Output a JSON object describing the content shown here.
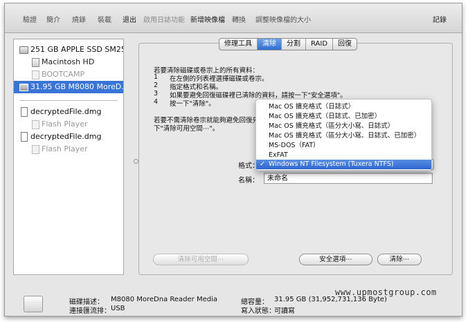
{
  "toolbar": {
    "items": [
      "驗證",
      "簡介",
      "燒錄",
      "裝載",
      "退出",
      "啟用日誌功能",
      "新增映像檔",
      "轉換",
      "調整映像檔的大小"
    ],
    "log_label": "記錄"
  },
  "sidebar": {
    "items": [
      {
        "label": "251 GB APPLE SSD SM25..."
      },
      {
        "label": "Macintosh HD"
      },
      {
        "label": "BOOTCAMP"
      },
      {
        "label": "31.95 GB M8080 MoreD..."
      },
      {
        "label": "decryptedFile.dmg"
      },
      {
        "label": "Flash Player"
      },
      {
        "label": "decryptedFile.dmg"
      },
      {
        "label": "Flash Player"
      }
    ]
  },
  "tabs": [
    "修理工具",
    "清除",
    "分割",
    "RAID",
    "回復"
  ],
  "active_tab": "清除",
  "instructions": {
    "intro": "若要清除磁碟或卷宗上的所有資料：",
    "steps": [
      {
        "num": "1",
        "text": "在左側的列表裡選擇磁碟或卷宗。"
      },
      {
        "num": "2",
        "text": "指定格式和名稱。"
      },
      {
        "num": "3",
        "text": "如果要避免回復磁碟裡已清除的資料，請按一下\"安全選項\"。"
      },
      {
        "num": "4",
        "text": "按一下\"清除\"。"
      }
    ],
    "note_line1": "若要不需清除卷宗就能夠避免回復先",
    "note_line2": "下\"清除可用空間⋯\"。"
  },
  "format": {
    "label": "格式：",
    "options": [
      "Mac OS 擴充格式（日誌式）",
      "Mac OS 擴充格式（日誌式、已加密）",
      "Mac OS 擴充格式（區分大小寫、日誌式）",
      "Mac OS 擴充格式（區分大小寫、日誌式、已加密）",
      "MS-DOS（FAT）",
      "ExFAT",
      "Windows NT Filesystem (Tuxera NTFS)"
    ],
    "selected_index": 6,
    "check_glyph": "✓"
  },
  "name": {
    "label": "名稱：",
    "value": "未命名"
  },
  "buttons": {
    "erase_free_space": "清除可用空間⋯",
    "security_options": "安全選項⋯",
    "erase": "清除⋯"
  },
  "footer": {
    "disk_desc_label": "磁碟描述：",
    "disk_desc_value": "M8080 MoreDna Reader Media",
    "connection_label": "連接匯流排：",
    "connection_value": "USB",
    "capacity_label": "總容量：",
    "capacity_value": "31.95 GB (31,952,731,136 Byte)",
    "write_status_label": "寫入狀態：",
    "write_status_value": "可讀寫"
  },
  "watermark": "www.upmostgroup.com",
  "colors": {
    "selection": "#3875d7",
    "menu_highlight": "#2c66cf"
  }
}
